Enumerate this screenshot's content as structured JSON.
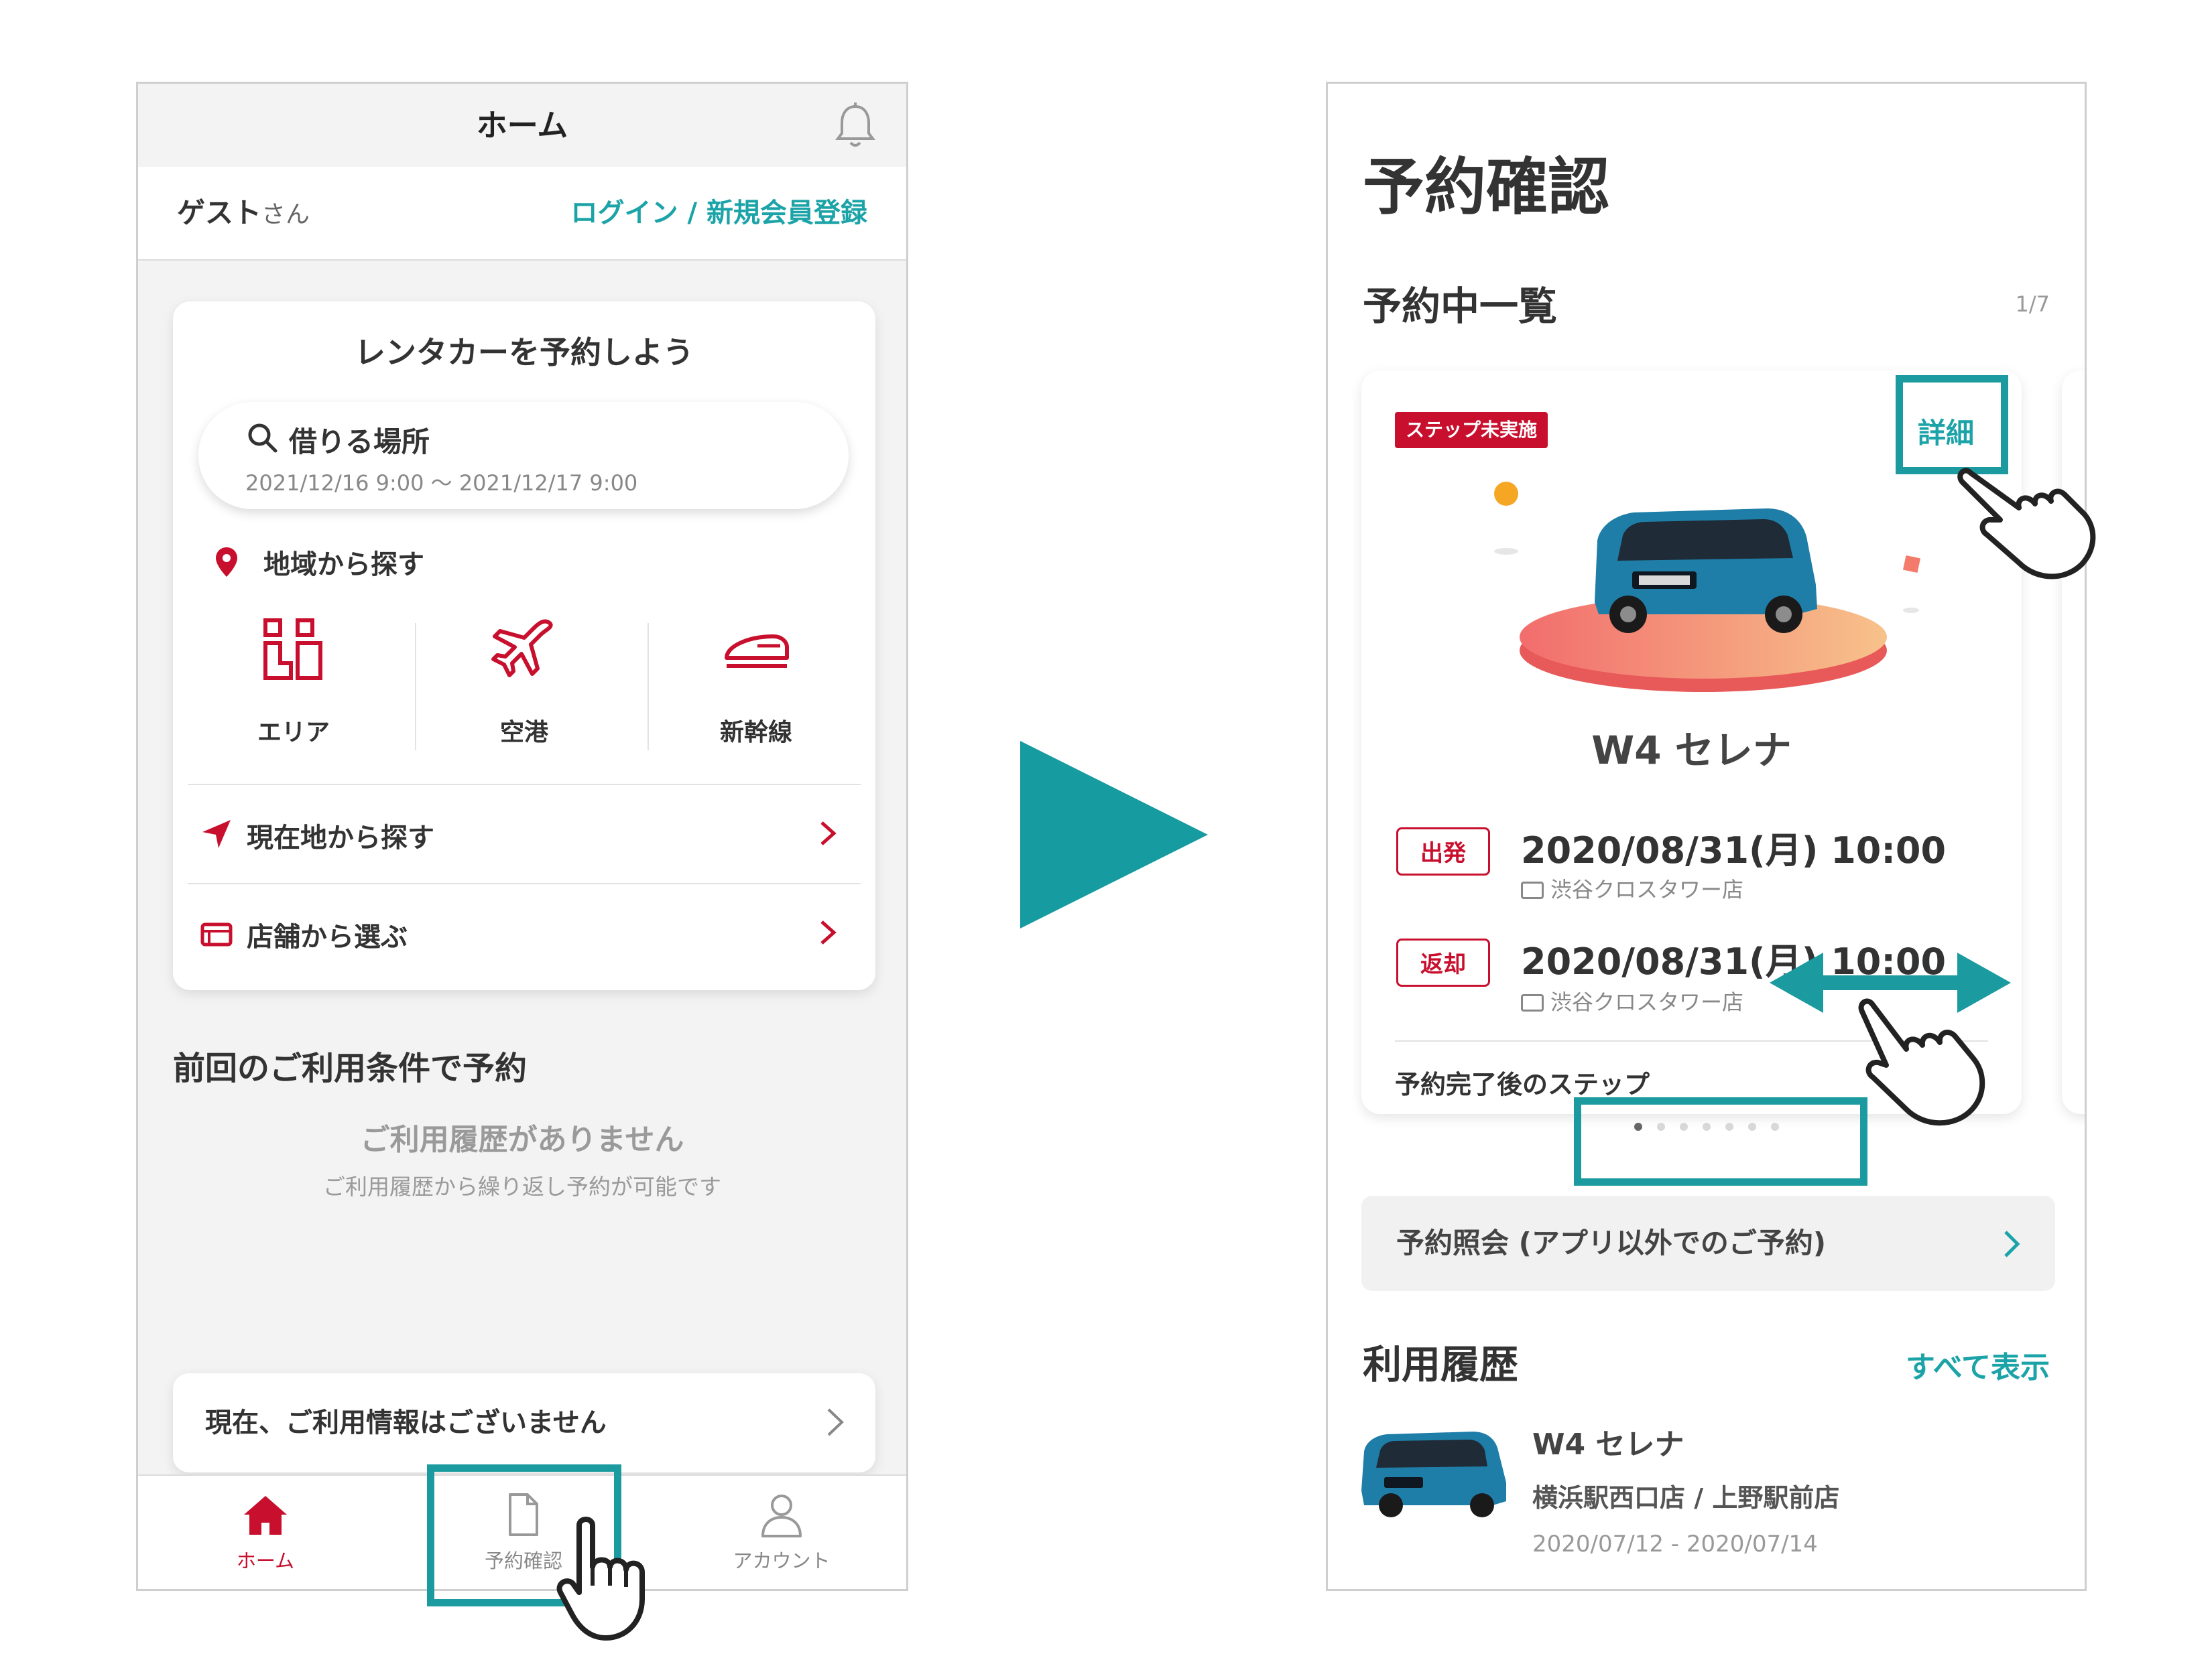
{
  "left_screen": {
    "header": {
      "title": "ホーム"
    },
    "guest_bar": {
      "guest_name": "ゲスト",
      "honorific": "さん",
      "login_link": "ログイン / 新規会員登録"
    },
    "booking_card": {
      "title": "レンタカーを予約しよう",
      "search": {
        "label": "借りる場所",
        "dates": "2021/12/16 9:00 〜 2021/12/17 9:00"
      },
      "region_label": "地域から探す",
      "categories": [
        {
          "label": "エリア",
          "icon": "area-icon"
        },
        {
          "label": "空港",
          "icon": "airplane-icon"
        },
        {
          "label": "新幹線",
          "icon": "bullet-train-icon"
        }
      ],
      "rows": [
        {
          "label": "現在地から探す",
          "icon": "location-arrow-icon"
        },
        {
          "label": "店舗から選ぶ",
          "icon": "shop-icon"
        }
      ]
    },
    "previous": {
      "title": "前回のご利用条件で予約",
      "empty_title": "ご利用履歴がありません",
      "empty_sub": "ご利用履歴から繰り返し予約が可能です"
    },
    "usage_card": {
      "label": "現在、ご利用情報はございません"
    },
    "tabbar": [
      {
        "label": "ホーム",
        "icon": "home-icon",
        "active": true
      },
      {
        "label": "予約確認",
        "icon": "document-icon",
        "active": false
      },
      {
        "label": "アカウント",
        "icon": "person-icon",
        "active": false
      }
    ]
  },
  "right_screen": {
    "page_title": "予約確認",
    "section_title": "予約中一覧",
    "pager": "1/7",
    "reservation": {
      "badge": "ステップ未実施",
      "detail_link": "詳細",
      "car_name": "W4 セレナ",
      "departure": {
        "tag": "出発",
        "datetime": "2020/08/31(月) 10:00",
        "shop": "渋谷クロスタワー店"
      },
      "return": {
        "tag": "返却",
        "datetime": "2020/08/31(月) 10:00",
        "shop": "渋谷クロスタワー店"
      },
      "next_steps": "予約完了後のステップ"
    },
    "carousel": {
      "count": 7,
      "active_index": 0
    },
    "inquiry": {
      "label": "予約照会 (アプリ以外でのご予約)"
    },
    "history": {
      "title": "利用履歴",
      "show_all": "すべて表示",
      "items": [
        {
          "car_name": "W4 セレナ",
          "shops": "横浜駅西口店 / 上野駅前店",
          "dates": "2020/07/12 - 2020/07/14"
        }
      ]
    }
  },
  "colors": {
    "brand_red": "#c8102e",
    "teal": "#1ba3a8",
    "highlight_teal": "#1b9ba0"
  }
}
